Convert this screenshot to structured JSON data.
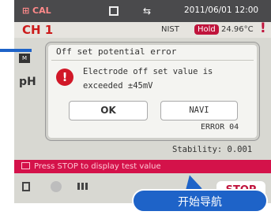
{
  "status_bar": {
    "mode": "⊞ CAL",
    "usb_icon": "usb-icon",
    "datetime": "2011/06/01 12:00"
  },
  "channel_row": {
    "channel": "CH 1",
    "buffer": "NIST",
    "hold": "Hold",
    "temperature": "24.96°C",
    "temperature_warning": "!"
  },
  "main": {
    "mini_box": "M",
    "ph_label": "pH",
    "stability": "Stability:   0.001"
  },
  "dialog": {
    "title": "Off set potential error",
    "icon": "error-icon",
    "message_line1": "Electrode off set value is",
    "message_line2": "exceeded ±45mV",
    "ok_label": "OK",
    "navi_label": "NAVI",
    "error_code": "ERROR 04"
  },
  "message_bar": {
    "text": "Press STOP to display test value"
  },
  "softkeys": {
    "stop_label": "STOP"
  },
  "callout": {
    "label": "开始导航",
    "color": "#1e63c8"
  },
  "colors": {
    "accent": "#c0143c",
    "status_bar": "#4a4a4c",
    "message_bar": "#d4124a"
  }
}
